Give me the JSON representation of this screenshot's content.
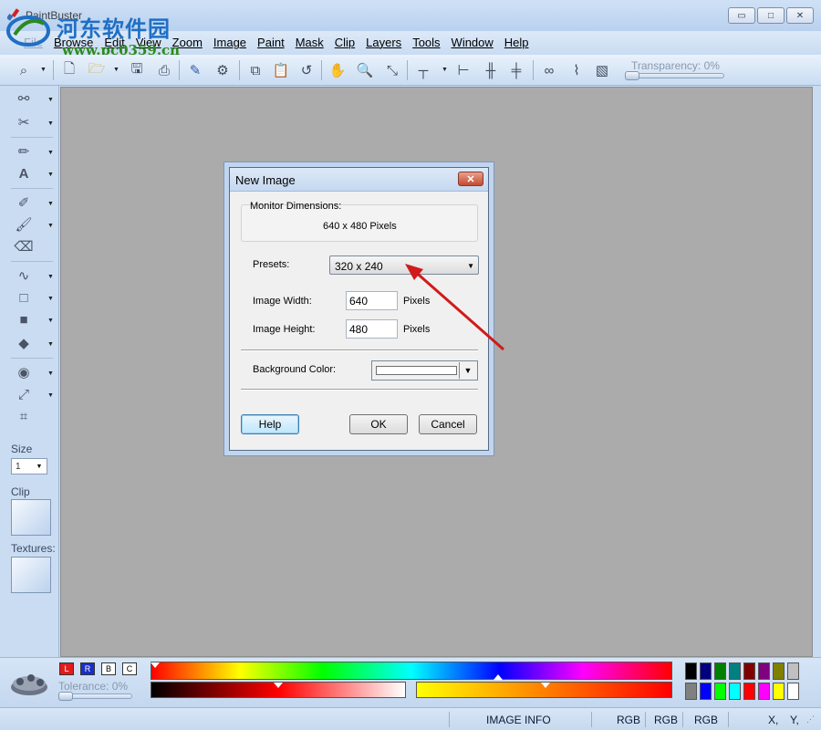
{
  "window": {
    "title": "PaintBuster",
    "watermark_cn": "河东软件园",
    "watermark_url": "www.pc0359.cn",
    "minimize_glyph": "▭",
    "maximize_glyph": "□",
    "close_glyph": "✕"
  },
  "menu": {
    "items": [
      "File",
      "Browse",
      "Edit",
      "View",
      "Zoom",
      "Image",
      "Paint",
      "Mask",
      "Clip",
      "Layers",
      "Tools",
      "Window",
      "Help"
    ]
  },
  "toolbar": {
    "transparency_label": "Transparency: 0%",
    "transparency_value": 0,
    "icons": [
      "zoom-select-icon",
      "new-file-icon",
      "open-folder-icon",
      "save-icon",
      "print-icon",
      "edit-image-icon",
      "batch-icon",
      "copy-icon",
      "paste-icon",
      "undo-icon",
      "hand-icon",
      "magnify-icon",
      "eyedropper-icon",
      "ruler-icon",
      "align-left-icon",
      "center-h-icon",
      "center-v-icon",
      "glasses-icon",
      "curve-icon",
      "stripes-icon"
    ]
  },
  "toolbox": {
    "size_label": "Size",
    "size_value": "1",
    "clip_label": "Clip",
    "textures_label": "Textures:"
  },
  "dialog": {
    "title": "New Image",
    "close_glyph": "✕",
    "monitor_label": "Monitor Dimensions:",
    "monitor_value": "640 x 480 Pixels",
    "presets_label": "Presets:",
    "presets_value": "320 x 240",
    "width_label": "Image Width:",
    "width_value": "640",
    "height_label": "Image Height:",
    "height_value": "480",
    "unit_label": "Pixels",
    "bg_label": "Background Color:",
    "bg_color": "#ffffff",
    "help_button": "Help",
    "ok_button": "OK",
    "cancel_button": "Cancel"
  },
  "palette": {
    "channels": [
      "L",
      "R",
      "B",
      "C"
    ],
    "tolerance_label": "Tolerance: 0%",
    "tolerance_value": 0,
    "swatches_top": [
      "#000000",
      "#000080",
      "#008000",
      "#008080",
      "#800000",
      "#800080",
      "#808000",
      "#c0c0c0"
    ],
    "swatches_bottom": [
      "#808080",
      "#0000ff",
      "#00ff00",
      "#00ffff",
      "#ff0000",
      "#ff00ff",
      "#ffff00",
      "#ffffff"
    ]
  },
  "status": {
    "image_info": "IMAGE INFO",
    "rgb1": "RGB",
    "rgb2": "RGB",
    "rgb3": "RGB",
    "x_label": "X,",
    "y_label": "Y,"
  },
  "colors": {
    "accent": "#c9dcf2",
    "workspace": "#ababab",
    "annotation_arrow": "#d11a1a"
  }
}
